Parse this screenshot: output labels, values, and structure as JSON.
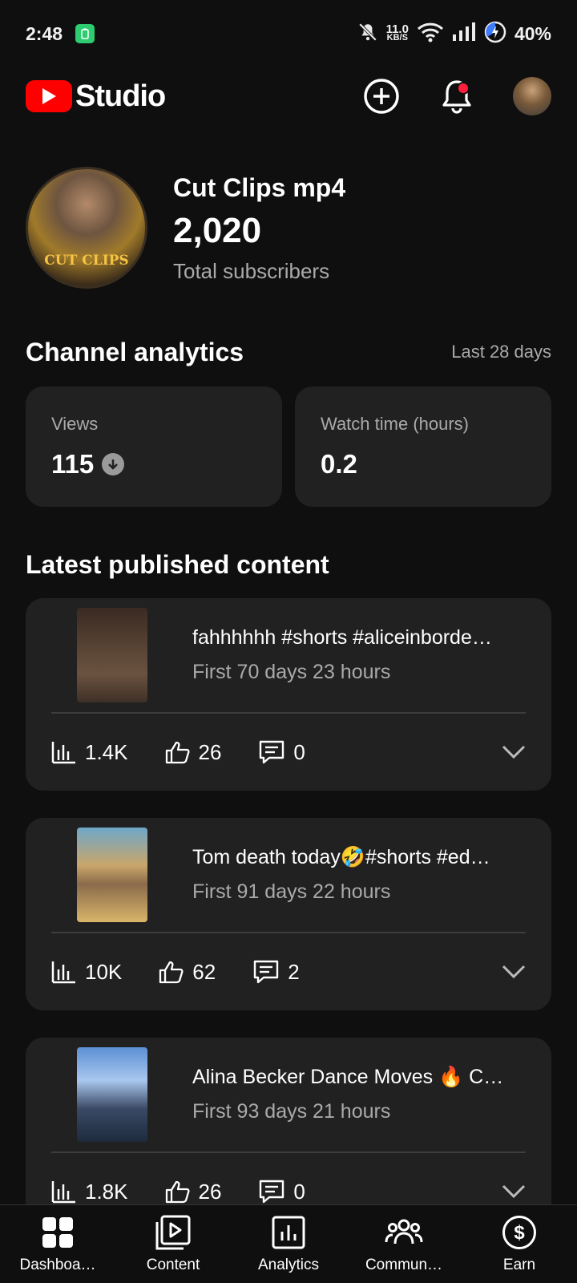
{
  "status_bar": {
    "time": "2:48",
    "net_speed_value": "11.0",
    "net_speed_unit": "KB/S",
    "battery": "40%"
  },
  "header": {
    "app_name": "Studio",
    "notification_dot_color": "#ff1f3d"
  },
  "channel": {
    "name": "Cut Clips mp4",
    "subscribers": "2,020",
    "subscribers_label": "Total subscribers",
    "avatar_text": "CUT CLIPS"
  },
  "analytics": {
    "title": "Channel analytics",
    "period": "Last 28 days",
    "cards": [
      {
        "label": "Views",
        "value": "115",
        "trend": "down"
      },
      {
        "label": "Watch time (hours)",
        "value": "0.2"
      }
    ]
  },
  "latest": {
    "title": "Latest published content",
    "items": [
      {
        "title": "fahhhhhh #shorts #aliceinborde…",
        "subtitle": "First 70 days 23 hours",
        "views": "1.4K",
        "likes": "26",
        "comments": "0"
      },
      {
        "title": "Tom death today🤣#shorts #ed…",
        "subtitle": "First 91 days 22 hours",
        "views": "10K",
        "likes": "62",
        "comments": "2"
      },
      {
        "title": "Alina Becker Dance Moves 🔥 C…",
        "subtitle": "First 93 days 21 hours",
        "views": "1.8K",
        "likes": "26",
        "comments": "0"
      }
    ]
  },
  "bottom_nav": {
    "items": [
      {
        "label": "Dashboa…",
        "icon": "dashboard-icon"
      },
      {
        "label": "Content",
        "icon": "content-icon"
      },
      {
        "label": "Analytics",
        "icon": "analytics-icon"
      },
      {
        "label": "Commun…",
        "icon": "community-icon"
      },
      {
        "label": "Earn",
        "icon": "earn-icon"
      }
    ]
  },
  "colors": {
    "background": "#0f0f0f",
    "card": "#212121",
    "accent": "#ff0000"
  }
}
